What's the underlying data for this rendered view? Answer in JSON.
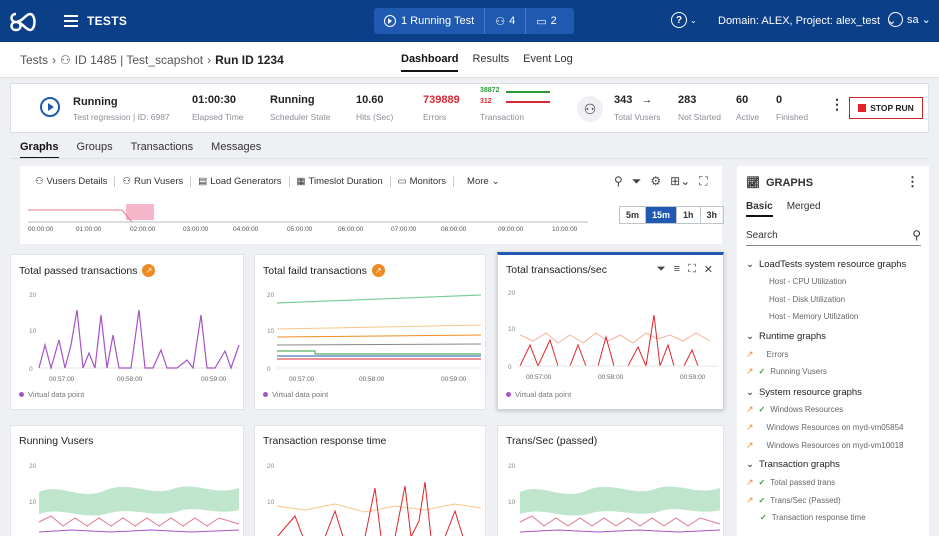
{
  "app": {
    "title": "TESTS",
    "running_test": "1 Running Test",
    "vusers_count": "4",
    "monitors_count": "2",
    "domain_label": "Domain: ALEX, Project: alex_test",
    "user": "sa"
  },
  "breadcrumb": {
    "root": "Tests",
    "test": "ID 1485 | Test_scapshot",
    "current": "Run ID 1234"
  },
  "views": [
    "Dashboard",
    "Results",
    "Event Log"
  ],
  "status": {
    "state": "Running",
    "state_sub": "Test regression | ID: 6987",
    "elapsed": "01:00:30",
    "elapsed_label": "Elapsed Time",
    "scheduler": "Running",
    "scheduler_label": "Scheduler State",
    "hits": "10.60",
    "hits_label": "Hits (Sec)",
    "errors": "739889",
    "errors_label": "Errors",
    "trans_pass": "38872",
    "trans_fail": "312",
    "trans_label": "Transaction",
    "total_vusers": "343",
    "total_vusers_label": "Total Vusers",
    "not_started": "283",
    "not_started_label": "Not Started",
    "active": "60",
    "active_label": "Active",
    "finished": "0",
    "finished_label": "Finished",
    "stop_label": "STOP RUN"
  },
  "subtabs": [
    "Graphs",
    "Groups",
    "Transactions",
    "Messages"
  ],
  "toolbar": {
    "items": [
      "Vusers Details",
      "Run Vusers",
      "Load Generators",
      "Timeslot Duration",
      "Monitors",
      "More"
    ],
    "ranges": [
      "5m",
      "15m",
      "1h",
      "3h"
    ],
    "active_range": "15m",
    "timeline_ticks": [
      "00:00:00",
      "01:00:00",
      "02:00:00",
      "03:00:00",
      "04:00:00",
      "05:00:00",
      "06:00:00",
      "07:00:00",
      "08:00:00",
      "09:00:00",
      "10:00:00"
    ]
  },
  "cards": [
    {
      "title": "Total passed transactions",
      "y_ticks": [
        "20",
        "10",
        "0"
      ],
      "x_ticks": [
        "00:57:00",
        "00:58:00",
        "00:59:00"
      ],
      "footer": "Virtual data point"
    },
    {
      "title": "Total faild transactions",
      "y_ticks": [
        "20",
        "10",
        "0"
      ],
      "x_ticks": [
        "00:57:00",
        "00:58:00",
        "00:59:00"
      ],
      "footer": "Virtual data point"
    },
    {
      "title": "Total transactions/sec",
      "y_ticks": [
        "20",
        "10",
        "0"
      ],
      "x_ticks": [
        "00:57:00",
        "00:58:00",
        "00:59:00"
      ],
      "footer": "Virtual data point"
    },
    {
      "title": "Running Vusers",
      "y_ticks": [
        "20",
        "10"
      ]
    },
    {
      "title": "Transaction response time",
      "y_ticks": [
        "20",
        "10"
      ]
    },
    {
      "title": "Trans/Sec (passed)",
      "y_ticks": [
        "20",
        "10"
      ]
    }
  ],
  "graphs_panel": {
    "title": "GRAPHS",
    "tabs": [
      "Basic",
      "Merged"
    ],
    "search_placeholder": "Search",
    "groups": [
      {
        "label": "LoadTests system resource graphs",
        "items": [
          "Host - CPU Utilization",
          "Host - Disk Utilization",
          "Host - Memory Utilization"
        ]
      },
      {
        "label": "Runtime graphs",
        "items": [
          "Errors",
          "Running Vusers"
        ]
      },
      {
        "label": "System resource graphs",
        "items": [
          "Windows Resources",
          "Windows Resources on myd-vm05854",
          "Windows Resources on myd-vm10018"
        ]
      },
      {
        "label": "Transaction graphs",
        "items": [
          "Total passed trans",
          "Trans/Sec (Passed)",
          "Transaction response time"
        ]
      }
    ]
  },
  "colors": {
    "topbar": "#0b3f87",
    "accent": "#1f5ab0",
    "error": "#d62837",
    "pass": "#2e9b3a",
    "orange": "#f08a24",
    "purple": "#a454c6"
  }
}
